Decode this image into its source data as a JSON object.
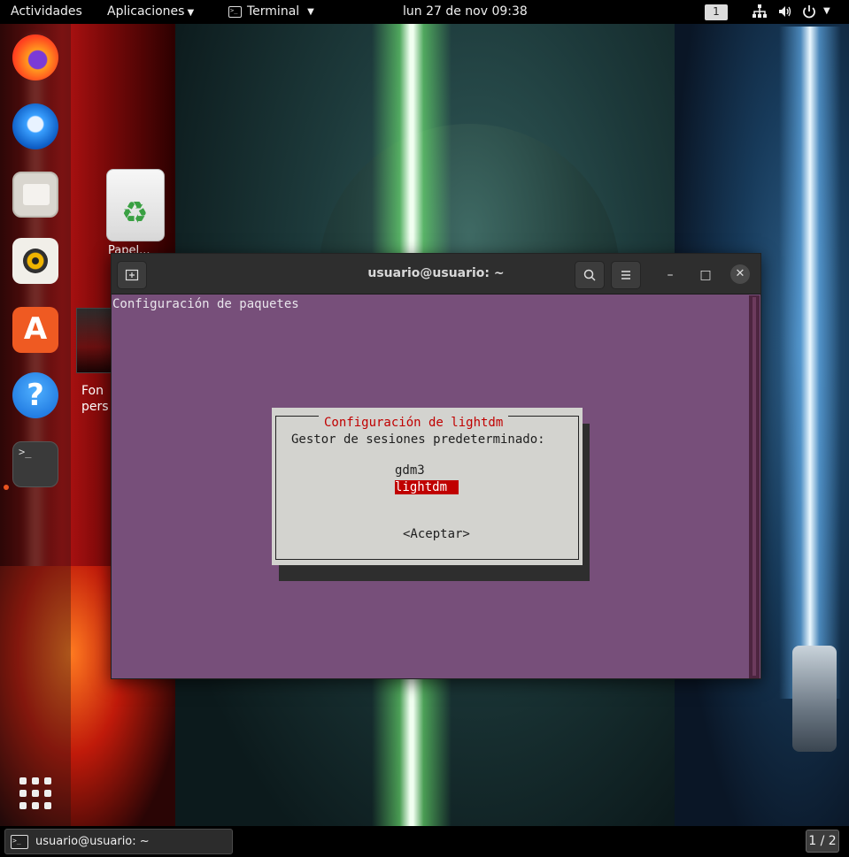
{
  "topbar": {
    "activities": "Actividades",
    "applications": "Aplicaciones",
    "app_menu": "Terminal",
    "clock": "lun 27 de nov  09:38",
    "workspace_badge": "1"
  },
  "dock": {
    "items": [
      {
        "name": "Firefox",
        "icon": "firefox-icon"
      },
      {
        "name": "Thunderbird",
        "icon": "thunderbird-icon"
      },
      {
        "name": "Archivos",
        "icon": "files-icon"
      },
      {
        "name": "Rhythmbox",
        "icon": "rhythmbox-icon"
      },
      {
        "name": "Ubuntu Software",
        "icon": "software-icon"
      },
      {
        "name": "Ayuda",
        "icon": "help-icon"
      },
      {
        "name": "Terminal",
        "icon": "terminal-icon"
      }
    ],
    "terminal_glyph": ">_",
    "show_apps_icon": "grid-icon"
  },
  "desktop": {
    "trash_label": "Papel...",
    "wallpaper_label": "Fon\npers"
  },
  "window": {
    "title": "usuario@usuario: ~",
    "new_tab_icon": "new-tab-icon",
    "search_icon": "search-icon",
    "menu_icon": "hamburger-icon",
    "minimize": "–",
    "maximize": "□",
    "close": "✕"
  },
  "terminal": {
    "package_title": "Configuración de paquetes",
    "dialog": {
      "title": "Configuración de lightdm",
      "question": "Gestor de sesiones predeterminado:",
      "options": [
        "gdm3",
        "lightdm"
      ],
      "selected_option": "lightdm",
      "accept": "<Aceptar>"
    }
  },
  "taskbar": {
    "task_label": "usuario@usuario: ~",
    "workspace_indicator": "1 / 2"
  },
  "colors": {
    "terminal_bg": "#774f7a",
    "dialog_bg": "#d3d3cf",
    "dialog_title": "#c00000",
    "selection": "#c00000"
  }
}
